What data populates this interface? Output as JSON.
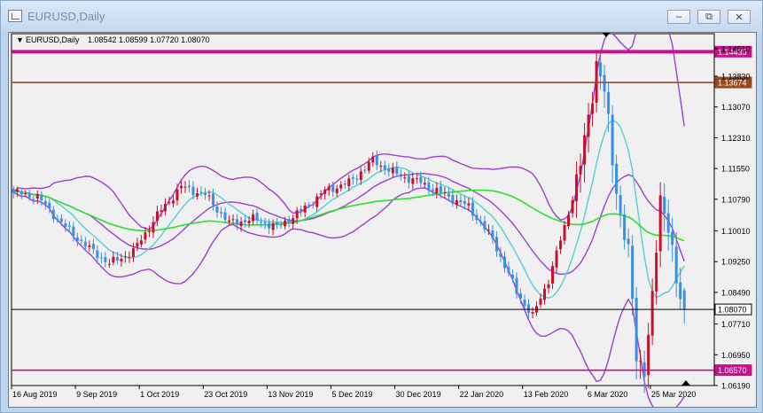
{
  "window": {
    "title": "EURUSD,Daily"
  },
  "header": {
    "symbol_label": "EURUSD,Daily",
    "ohlc_text": "1.08542 1.08599 1.07720 1.08070"
  },
  "colors": {
    "up": "#c8102e",
    "down": "#3a8fe0",
    "ma_fast": "#52d0d0",
    "ma_slow": "#2ee02e",
    "bands": "#9b3fd0",
    "level_magenta": "#c8108c",
    "level_brown": "#9b4a1e",
    "current": "#000000",
    "background": "#f0f0f0"
  },
  "chart_data": {
    "type": "candlestick",
    "symbol": "EURUSD",
    "timeframe": "Daily",
    "last_ohlc": {
      "open": 1.08542,
      "high": 1.08599,
      "low": 1.0772,
      "close": 1.0807
    },
    "ylim": [
      1.0619,
      1.1488
    ],
    "y_ticks": [
      1.1451,
      1.1383,
      1.1307,
      1.1231,
      1.1155,
      1.1079,
      1.1001,
      1.0925,
      1.0849,
      1.0771,
      1.0695,
      1.0619
    ],
    "y_tick_labels": [
      "1.14510",
      "1.13830",
      "1.13070",
      "1.12310",
      "1.11550",
      "1.10790",
      "1.10010",
      "1.09250",
      "1.08490",
      "1.07710",
      "1.06950",
      "1.06190"
    ],
    "x_tick_labels": [
      "16 Aug 2019",
      "9 Sep 2019",
      "1 Oct 2019",
      "23 Oct 2019",
      "13 Nov 2019",
      "5 Dec 2019",
      "30 Dec 2019",
      "22 Jan 2020",
      "13 Feb 2020",
      "6 Mar 2020",
      "25 Mar 2020"
    ],
    "x_tick_index": [
      0,
      16,
      32,
      48,
      64,
      80,
      96,
      112,
      128,
      144,
      160
    ],
    "levels": [
      {
        "value": 1.14435,
        "label": "1.14435",
        "color": "#c8108c",
        "style": "thick"
      },
      {
        "value": 1.13674,
        "label": "1.13674",
        "color": "#9b4a1e",
        "style": "normal"
      },
      {
        "value": 1.0807,
        "label": "1.08070",
        "color": "#000000",
        "style": "thin"
      },
      {
        "value": 1.0657,
        "label": "1.06570",
        "color": "#c8108c",
        "style": "normal"
      }
    ],
    "anchors": [
      [
        0,
        1.1095
      ],
      [
        6,
        1.1085
      ],
      [
        12,
        1.102
      ],
      [
        18,
        1.0965
      ],
      [
        24,
        1.092
      ],
      [
        30,
        1.095
      ],
      [
        36,
        1.104
      ],
      [
        42,
        1.111
      ],
      [
        48,
        1.109
      ],
      [
        54,
        1.102
      ],
      [
        60,
        1.103
      ],
      [
        66,
        1.101
      ],
      [
        72,
        1.105
      ],
      [
        78,
        1.11
      ],
      [
        84,
        1.112
      ],
      [
        90,
        1.1175
      ],
      [
        96,
        1.114
      ],
      [
        102,
        1.112
      ],
      [
        108,
        1.109
      ],
      [
        114,
        1.106
      ],
      [
        120,
        1.098
      ],
      [
        126,
        1.085
      ],
      [
        130,
        1.079
      ],
      [
        134,
        1.088
      ],
      [
        138,
        1.101
      ],
      [
        142,
        1.116
      ],
      [
        144,
        1.128
      ],
      [
        146,
        1.142
      ],
      [
        148,
        1.134
      ],
      [
        150,
        1.118
      ],
      [
        152,
        1.104
      ],
      [
        154,
        1.094
      ],
      [
        156,
        1.07
      ],
      [
        158,
        1.066
      ],
      [
        160,
        1.082
      ],
      [
        162,
        1.109
      ],
      [
        164,
        1.102
      ],
      [
        166,
        1.086
      ],
      [
        168,
        1.0807
      ]
    ],
    "last_index": 168,
    "x_slots": 176
  }
}
